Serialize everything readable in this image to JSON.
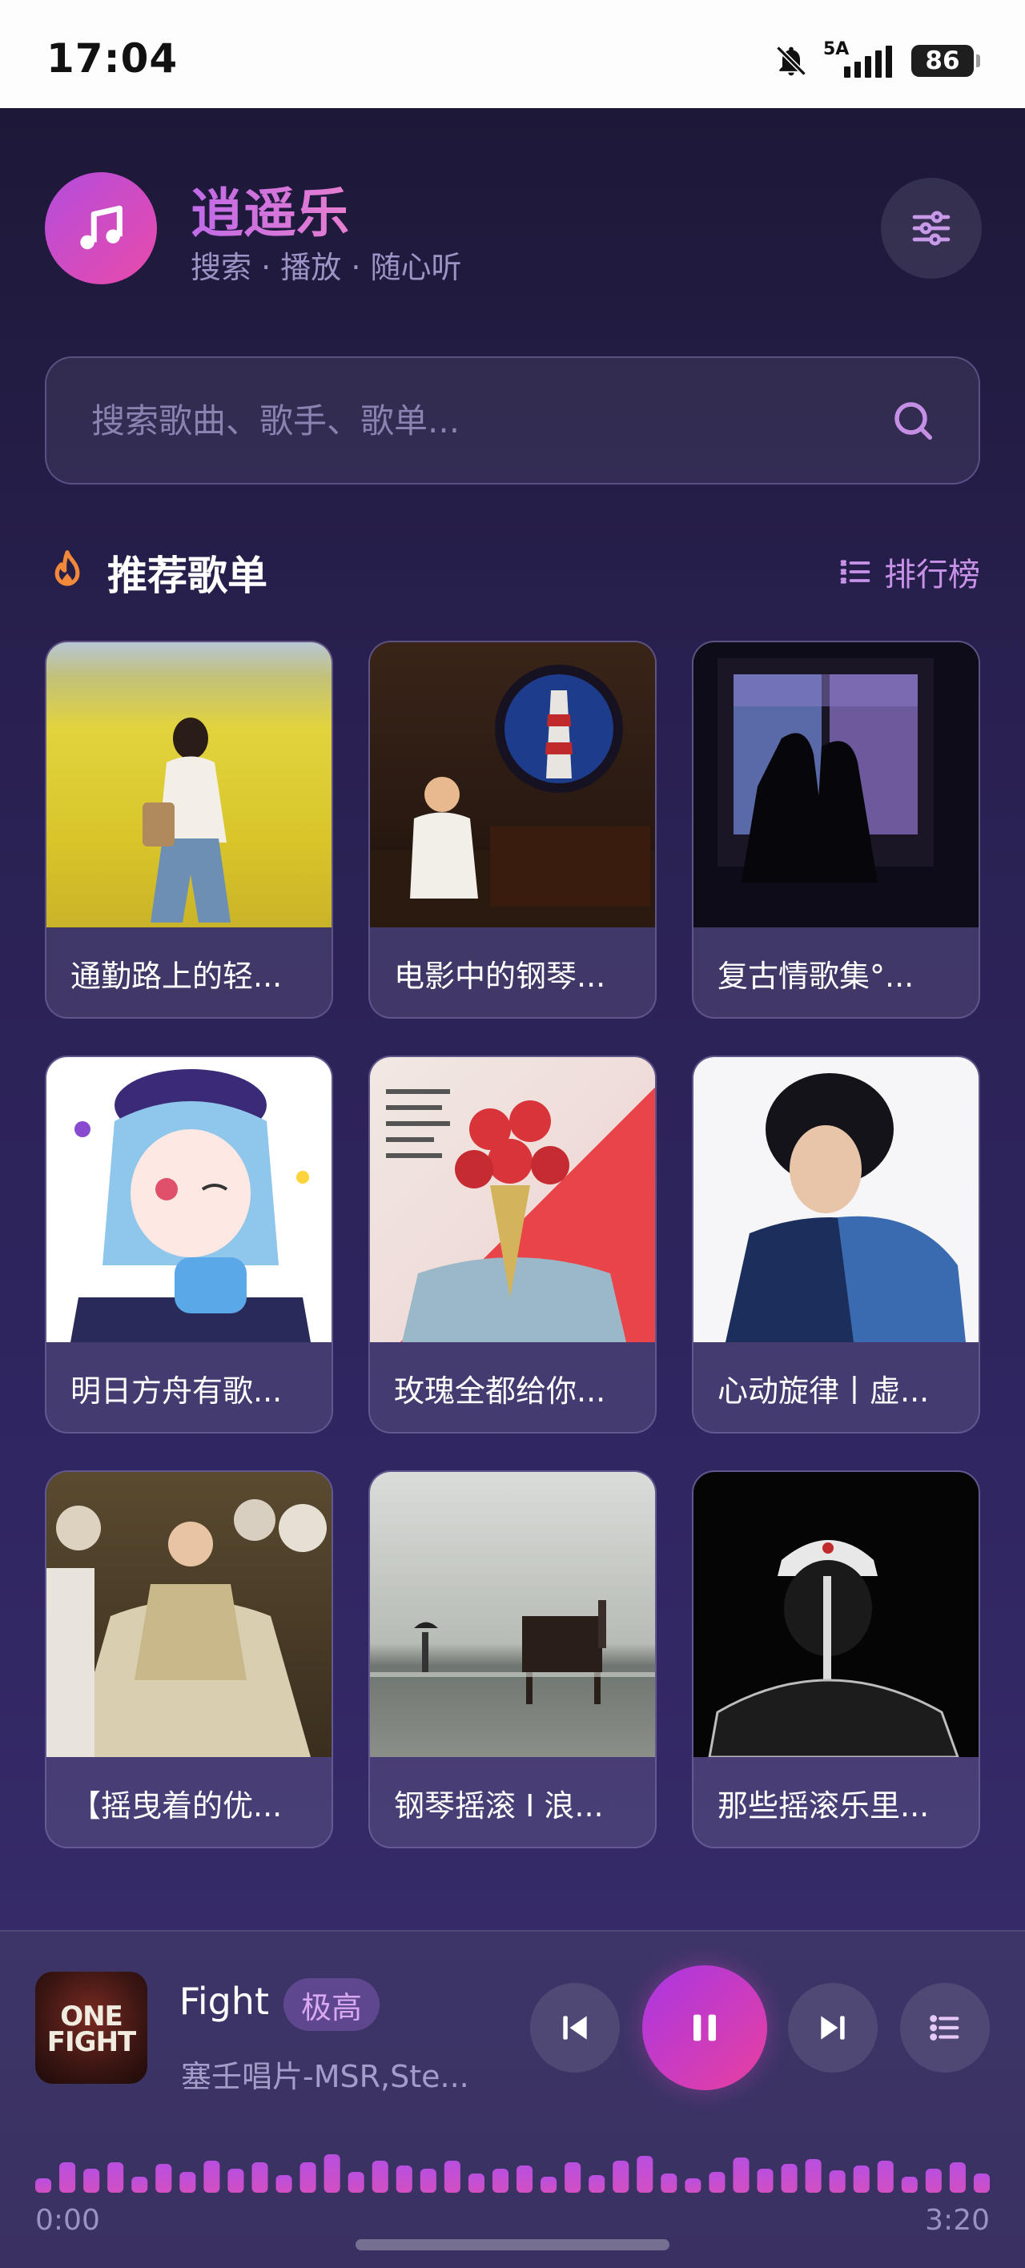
{
  "status_bar": {
    "time": "17:04",
    "network": "5A",
    "battery": "86"
  },
  "header": {
    "title": "逍遥乐",
    "subtitle": "搜索 · 播放 · 随心听"
  },
  "search": {
    "placeholder": "搜索歌曲、歌手、歌单..."
  },
  "section": {
    "title": "推荐歌单",
    "ranking_label": "排行榜"
  },
  "playlists": [
    {
      "title": "通勤路上的轻..."
    },
    {
      "title": "电影中的钢琴..."
    },
    {
      "title": "复古情歌集°..."
    },
    {
      "title": "明日方舟有歌..."
    },
    {
      "title": "玫瑰全都给你..."
    },
    {
      "title": "心动旋律丨虚..."
    },
    {
      "title": "【摇曳着的优..."
    },
    {
      "title": "钢琴摇滚 I 浪..."
    },
    {
      "title": "那些摇滚乐里..."
    }
  ],
  "player": {
    "track_title": "Fight",
    "quality": "极高",
    "artist": "塞壬唱片-MSR,Ste...",
    "time_current": "0:00",
    "time_total": "3:20",
    "album_art_text": "ONE FIGHT",
    "progress": 0
  },
  "colors": {
    "accent_start": "#a936e3",
    "accent_end": "#e8409f",
    "background": "#2a2152"
  }
}
